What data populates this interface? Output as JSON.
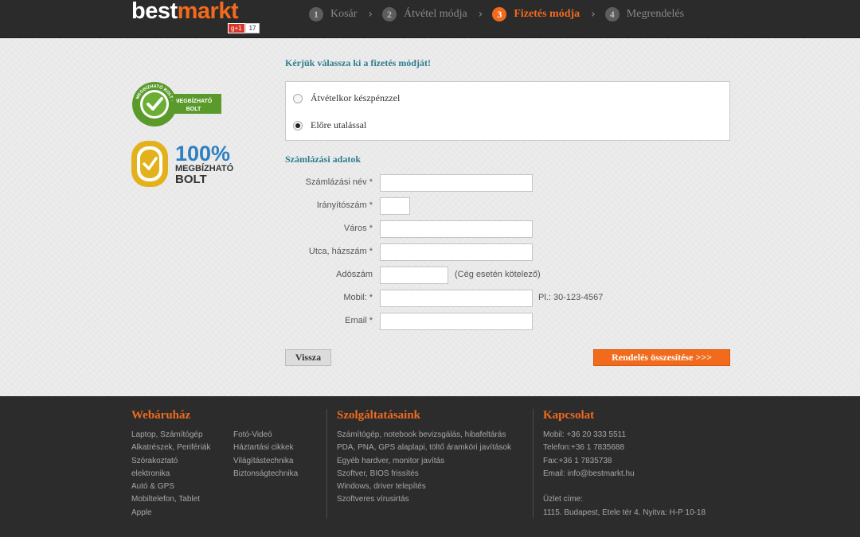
{
  "logo": {
    "word1": "best",
    "word2": "markt",
    "badge_g": "g+1",
    "badge_count": "17"
  },
  "steps": [
    {
      "num": "1",
      "label": "Kosár",
      "active": false
    },
    {
      "num": "2",
      "label": "Átvétel módja",
      "active": false
    },
    {
      "num": "3",
      "label": "Fizetés módja",
      "active": true
    },
    {
      "num": "4",
      "label": "Megrendelés",
      "active": false
    }
  ],
  "step_separator": "›",
  "badges": {
    "trusted_ring": "MEGBÍZHATÓ BOLT · ÁRUKERESŐ.HU",
    "trusted_text1": "MEGBÍZHATÓ",
    "trusted_text2": "BOLT",
    "hundred_percent": "100%",
    "hundred_text1": "MEGBÍZHATÓ",
    "hundred_text2": "BOLT"
  },
  "payment": {
    "prompt": "Kérjük válassza ki a fizetés módját!",
    "options": [
      {
        "label": "Átvételkor készpénzzel",
        "checked": false
      },
      {
        "label": "Előre utalással",
        "checked": true
      }
    ]
  },
  "billing": {
    "title": "Számlázási adatok",
    "fields": {
      "name": {
        "label": "Számlázási név *",
        "value": ""
      },
      "zip": {
        "label": "Irányítószám *",
        "value": ""
      },
      "city": {
        "label": "Város *",
        "value": ""
      },
      "street": {
        "label": "Utca, házszám *",
        "value": ""
      },
      "tax": {
        "label": "Adószám",
        "value": "",
        "hint": "(Cég esetén kötelező)"
      },
      "mobile": {
        "label": "Mobil: *",
        "value": "",
        "hint": "Pl.: 30-123-4567"
      },
      "email": {
        "label": "Email *",
        "value": ""
      }
    }
  },
  "buttons": {
    "back": "Vissza",
    "submit": "Rendelés összesítése >>>"
  },
  "footer": {
    "shop": {
      "title": "Webáruház",
      "col1": [
        "Laptop, Számítógép",
        "Alkatrészek, Perifériák",
        "Szórakoztató",
        "elektronika",
        "Autó & GPS",
        "Mobiltelefon, Tablet",
        "Apple"
      ],
      "col2": [
        "Fotó-Videó",
        "Háztartási cikkek",
        "Világítástechnika",
        "Biztonságtechnika"
      ]
    },
    "services": {
      "title": "Szolgáltatásaink",
      "items": [
        "Számítógép, notebook bevizsgálás, hibafeltárás",
        "PDA, PNA, GPS alaplapi, töltő áramköri javítások",
        "Egyéb hardver, monitor javítás",
        "Szoftver, BIOS frissítés",
        "Windows, driver telepítés",
        "Szoftveres vírusirtás"
      ]
    },
    "contact": {
      "title": "Kapcsolat",
      "items": [
        "Mobil: +36 20 333 5511",
        "Telefon:+36 1 7835688",
        "Fax:+36 1 7835738",
        "Email: info@bestmarkt.hu"
      ],
      "store_title": "Üzlet címe:",
      "store_address": "1115. Budapest, Etele tér 4. Nyitva: H-P 10-18"
    }
  },
  "colors": {
    "accent": "#f26b1d",
    "heading_teal": "#2e7d8f",
    "header_bg": "#2b2b2b",
    "footer_bg": "#2c2c2c",
    "badge_green": "#5a9a2b",
    "badge_gold": "#e3b11b",
    "badge_blue": "#2f7fc1"
  }
}
